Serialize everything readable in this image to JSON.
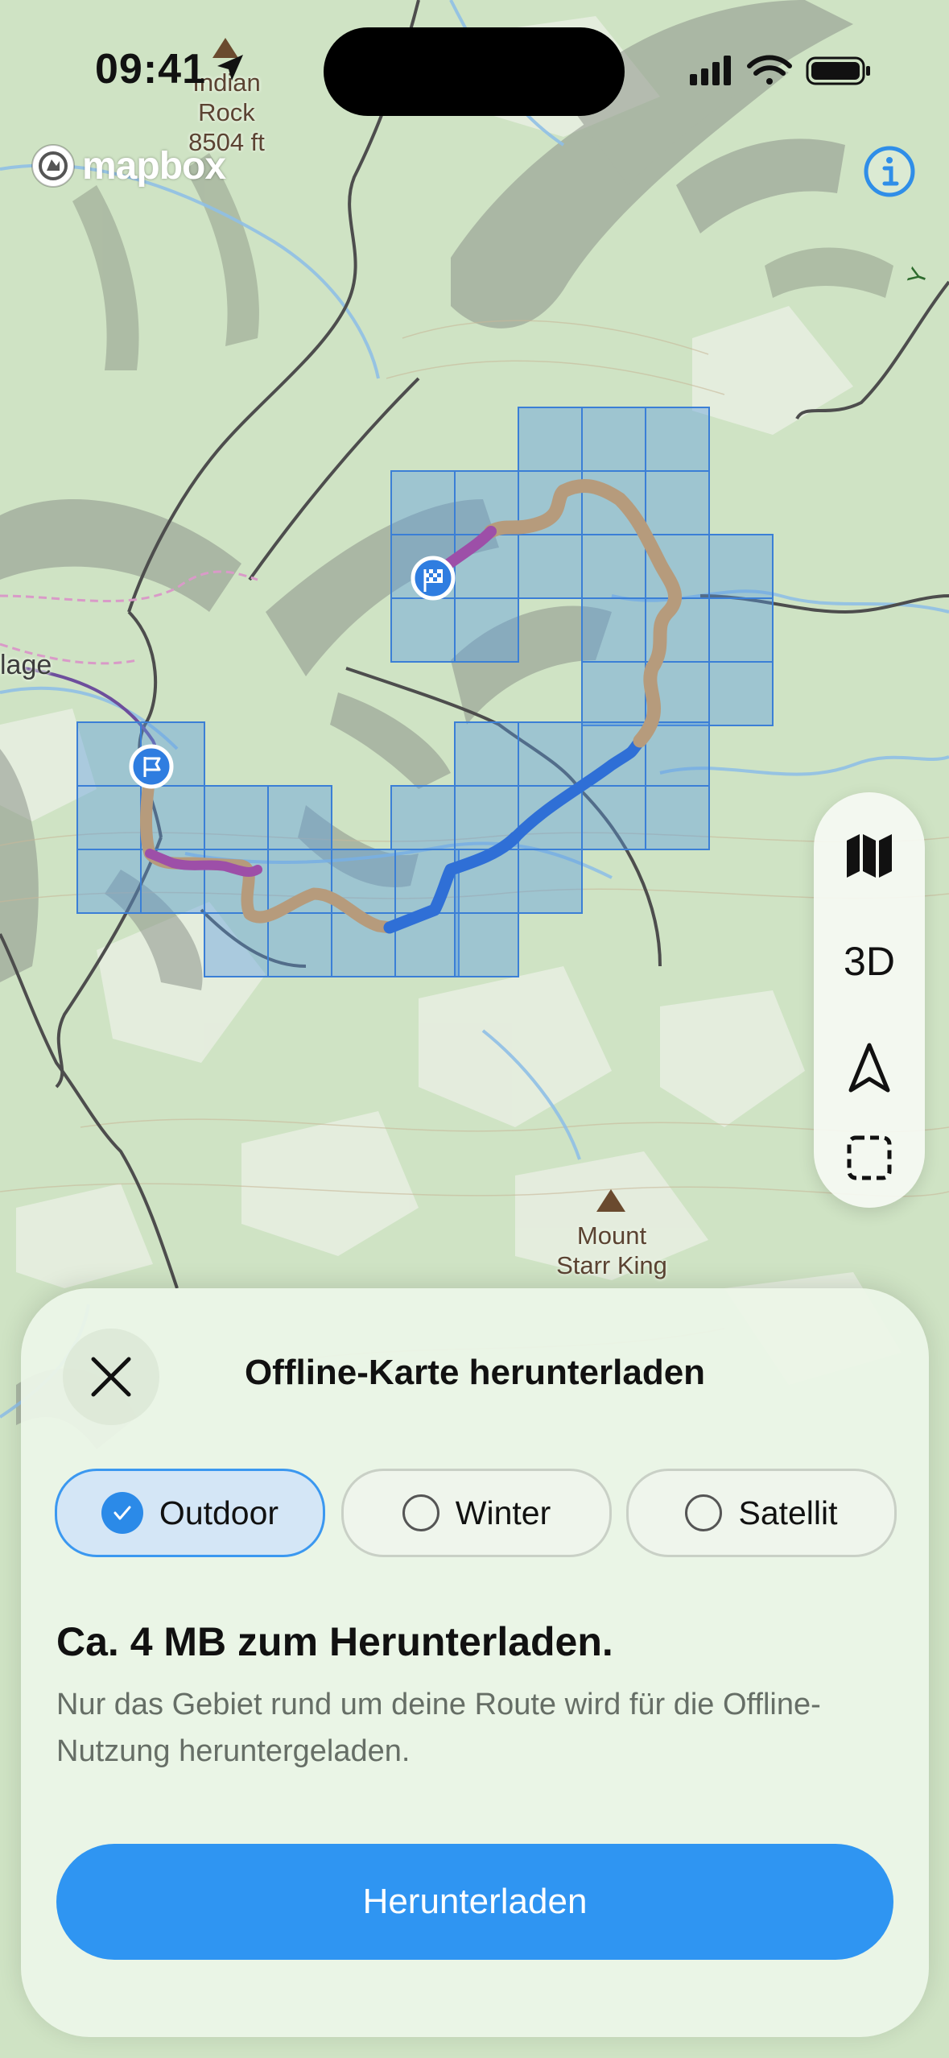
{
  "status_bar": {
    "time": "09:41"
  },
  "map": {
    "attribution_logo": "mapbox",
    "labels": {
      "indian_rock": "Indian\nRock\n8504 ft",
      "village_partial": "lage",
      "mount_starr_king": "Mount\nStarr King"
    },
    "icons": {
      "info": "info-icon",
      "route_start": "flag-icon",
      "route_finish": "checkered-flag-icon",
      "peak": "peak-triangle-icon"
    },
    "colors": {
      "terrain": "#cfe3c4",
      "tile_fill": "#5a9be0",
      "route_neutral": "#b69b7c",
      "route_blue": "#2f6fd6",
      "route_purple": "#9d4fa8",
      "accent": "#2f95f2"
    }
  },
  "map_controls": {
    "layers_icon": "map-layers-icon",
    "mode_3d_label": "3D",
    "locate_icon": "navigation-arrow-icon",
    "select_icon": "selection-frame-icon"
  },
  "sheet": {
    "title": "Offline-Karte herunterladen",
    "map_types": [
      {
        "label": "Outdoor",
        "selected": true
      },
      {
        "label": "Winter",
        "selected": false
      },
      {
        "label": "Satellit",
        "selected": false
      }
    ],
    "size_text": "Ca. 4 MB zum Herunterladen.",
    "description": "Nur das Gebiet rund um deine Route wird für die Offline-Nutzung heruntergeladen.",
    "download_label": "Herunterladen"
  }
}
